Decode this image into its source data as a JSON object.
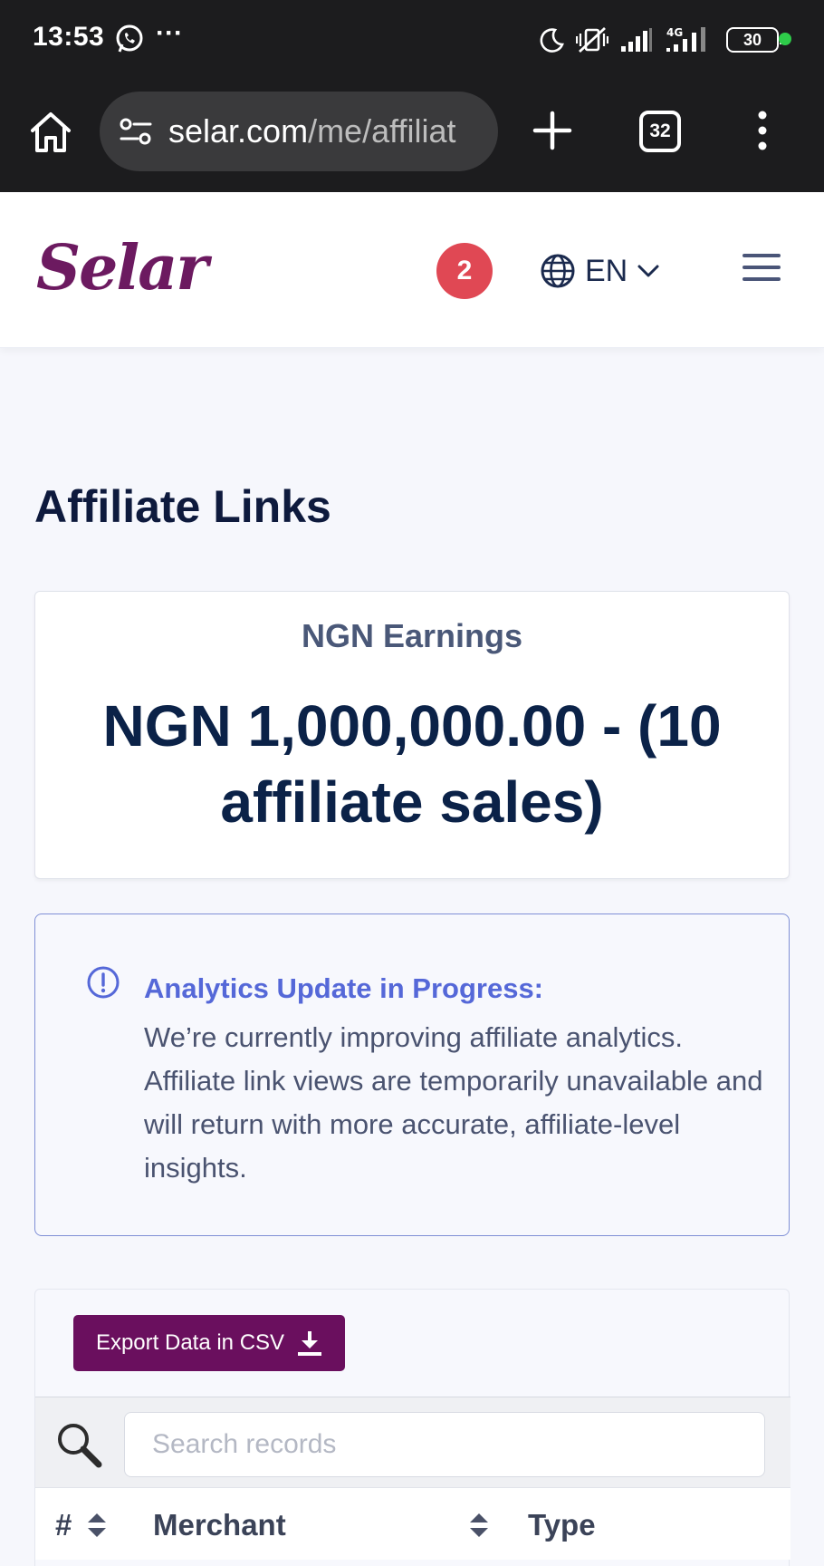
{
  "status_bar": {
    "time": "13:53",
    "dots": "···",
    "battery": "30",
    "network": "4G"
  },
  "browser": {
    "url_host": "selar.com",
    "url_path": "/me/affiliat",
    "tab_count": "32"
  },
  "header": {
    "logo": "Selar",
    "notification_count": "2",
    "language": "EN"
  },
  "page": {
    "title": "Affiliate Links"
  },
  "earnings": {
    "label": "NGN Earnings",
    "value": "NGN 1,000,000.00 - (10 affiliate sales)"
  },
  "notice": {
    "title": "Analytics Update in Progress:",
    "body": "We’re currently improving affiliate analytics. Affiliate link views are temporarily unavailable and will return with more accurate, affiliate-level insights."
  },
  "table": {
    "export_label": "Export Data in CSV",
    "search_placeholder": "Search records",
    "columns": [
      "#",
      "Merchant",
      "Type"
    ]
  },
  "colors": {
    "brand": "#6a0f5e",
    "badge": "#e04854",
    "notice_accent": "#5568d8",
    "heading": "#0e1a3d"
  }
}
